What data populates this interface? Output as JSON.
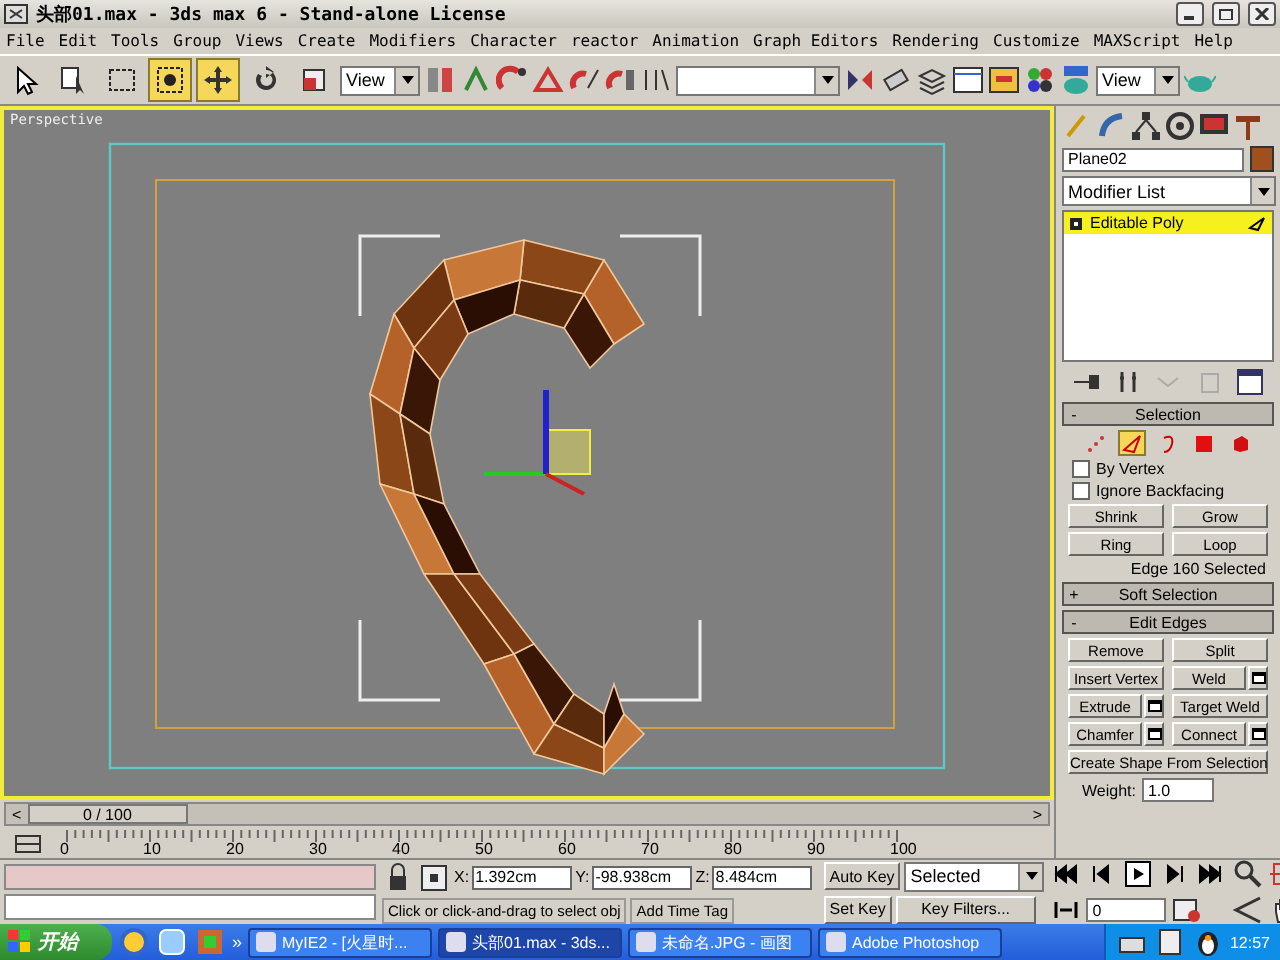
{
  "window": {
    "title": "头部01.max - 3ds max 6 - Stand-alone License"
  },
  "menu": [
    "File",
    "Edit",
    "Tools",
    "Group",
    "Views",
    "Create",
    "Modifiers",
    "Character",
    "reactor",
    "Animation",
    "Graph Editors",
    "Rendering",
    "Customize",
    "MAXScript",
    "Help"
  ],
  "toolbar": {
    "tools": [
      {
        "kind": "select",
        "selected": false
      },
      {
        "kind": "select_by_name",
        "selected": false
      },
      {
        "kind": "region",
        "selected": false
      },
      {
        "kind": "crossing",
        "selected": true
      },
      {
        "kind": "move",
        "selected": true
      },
      {
        "kind": "rotate",
        "selected": false
      },
      {
        "kind": "scale",
        "selected": false
      }
    ],
    "reference_coordinate": "View",
    "render_type": "View"
  },
  "viewport": {
    "label": "Perspective"
  },
  "command_panel": {
    "object_name": "Plane02",
    "modifier_list": "Modifier List",
    "stack": [
      {
        "label": "Editable Poly",
        "selected": true
      }
    ],
    "selection": {
      "sign": "-",
      "title": "Selection",
      "levels": [
        {
          "kind": "vertex",
          "selected": false
        },
        {
          "kind": "edge",
          "selected": true
        },
        {
          "kind": "border",
          "selected": false
        },
        {
          "kind": "polygon",
          "selected": false
        },
        {
          "kind": "element",
          "selected": false
        }
      ],
      "options": [
        {
          "label": "By Vertex",
          "checked": false
        },
        {
          "label": "Ignore Backfacing",
          "checked": false
        }
      ],
      "buttons": [
        "Shrink",
        "Grow",
        "Ring",
        "Loop"
      ],
      "status": "Edge 160 Selected"
    },
    "rollouts": [
      {
        "sign": "+",
        "title": "Soft Selection"
      },
      {
        "sign": "-",
        "title": "Edit Edges"
      }
    ],
    "edit_buttons": [
      {
        "label": "Remove",
        "settings": false
      },
      {
        "label": "Split",
        "settings": false
      },
      {
        "label": "Insert Vertex",
        "settings": false
      },
      {
        "label": "Weld",
        "settings": true
      },
      {
        "label": "Extrude",
        "settings": true
      },
      {
        "label": "Target Weld",
        "settings": false
      },
      {
        "label": "Chamfer",
        "settings": true
      },
      {
        "label": "Connect",
        "settings": true
      }
    ],
    "wide_button": "Create Shape From Selection",
    "weight_label": "Weight:",
    "weight": "1.0"
  },
  "time_slider": {
    "prev": "<",
    "position": "0 / 100",
    "next": ">",
    "level": 0
  },
  "timeline_labels": [
    "0",
    "10",
    "20",
    "30",
    "40",
    "50",
    "60",
    "70",
    "80",
    "90",
    "100"
  ],
  "status": {
    "coords": [
      {
        "axis": "X:",
        "value": "1.392cm"
      },
      {
        "axis": "Y:",
        "value": "-98.938cm"
      },
      {
        "axis": "Z:",
        "value": "8.484cm"
      }
    ],
    "prompt": "Click or click-and-drag to select obj",
    "time_tag": "Add Time Tag",
    "auto_key": "Auto Key",
    "set_key": "Set Key",
    "key_set": "Selected",
    "key_filters": "Key Filters...",
    "frame": "0"
  },
  "taskbar": {
    "start": "开始",
    "more": "»",
    "tasks": [
      {
        "label": "MyIE2 - [火星时...",
        "selected": false
      },
      {
        "label": "头部01.max - 3ds...",
        "selected": true
      },
      {
        "label": "未命名.JPG - 画图",
        "selected": false
      },
      {
        "label": "Adobe Photoshop",
        "selected": false
      }
    ],
    "clock": "12:57"
  }
}
